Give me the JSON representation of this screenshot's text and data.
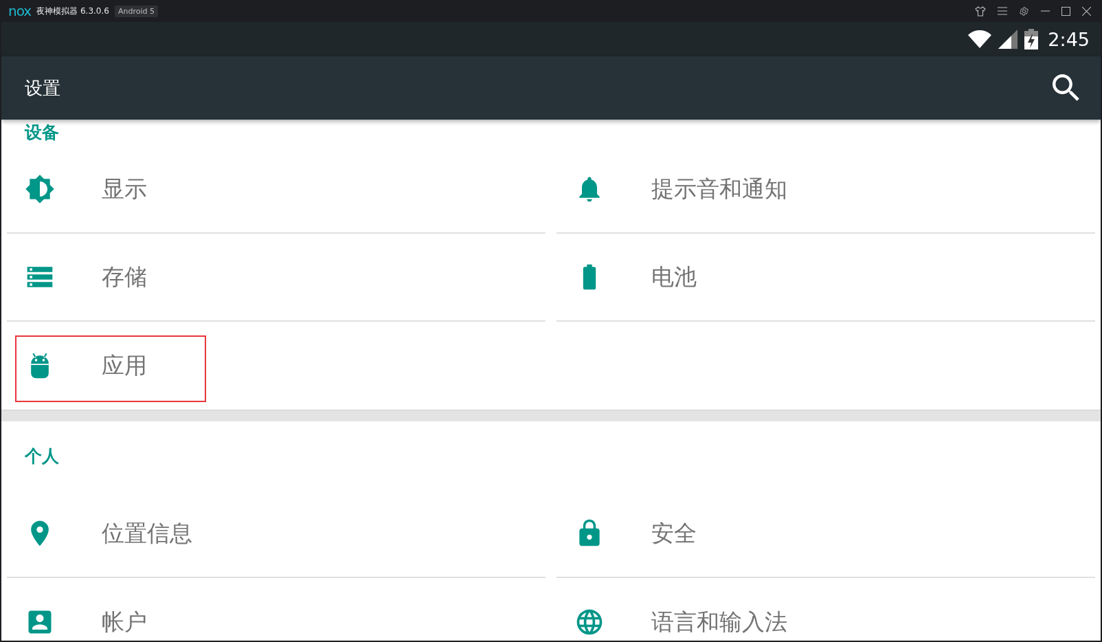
{
  "app_window": {
    "logo": "nox",
    "title": "夜神模拟器 6.3.0.6",
    "badge": "Android 5"
  },
  "status_bar": {
    "time": "2:45"
  },
  "toolbar": {
    "title": "设置"
  },
  "sections": [
    {
      "header": "设备",
      "items": [
        {
          "label": "显示",
          "kind": "brightness",
          "highlighted": false
        },
        {
          "label": "提示音和通知",
          "kind": "bell",
          "highlighted": false
        },
        {
          "label": "存储",
          "kind": "storage",
          "highlighted": false
        },
        {
          "label": "电池",
          "kind": "battery",
          "highlighted": false
        },
        {
          "label": "应用",
          "kind": "android",
          "highlighted": true
        }
      ]
    },
    {
      "header": "个人",
      "items": [
        {
          "label": "位置信息",
          "kind": "pin",
          "highlighted": false
        },
        {
          "label": "安全",
          "kind": "lock",
          "highlighted": false
        },
        {
          "label": "帐户",
          "kind": "account",
          "highlighted": false
        },
        {
          "label": "语言和输入法",
          "kind": "globe",
          "highlighted": false
        }
      ]
    }
  ]
}
